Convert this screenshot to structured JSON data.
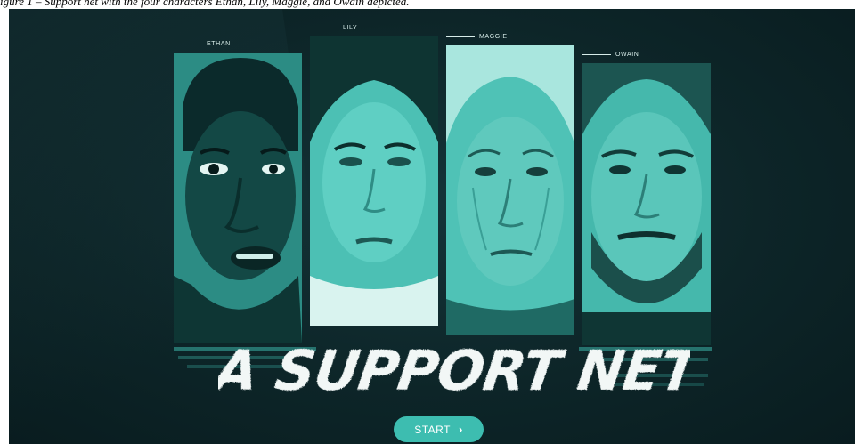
{
  "caption": "igure 1 – Support net with the four characters Ethan, Lily, Maggie, and Owain depicted.",
  "characters": [
    {
      "name": "ETHAN"
    },
    {
      "name": "LILY"
    },
    {
      "name": "MAGGIE"
    },
    {
      "name": "OWAIN"
    }
  ],
  "title": "A SUPPORT NET",
  "start_button": {
    "label": "START",
    "icon": "chevron-right-icon"
  },
  "colors": {
    "background": "#0d2528",
    "portrait_teal": "#3fb3a8",
    "accent": "#3dbdb0",
    "text": "#ffffff"
  }
}
